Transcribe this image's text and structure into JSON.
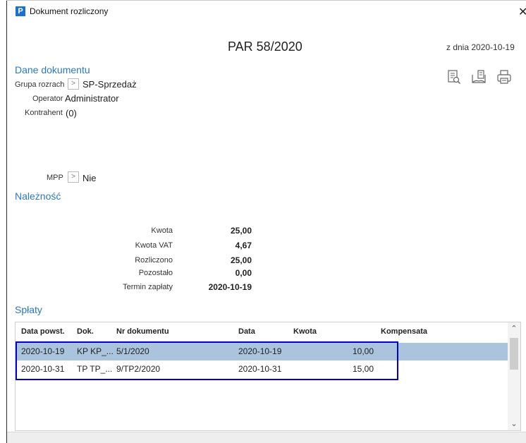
{
  "window": {
    "title": "Dokument rozliczony",
    "app_icon_letter": "P",
    "close_glyph": "✕"
  },
  "document": {
    "number": "PAR 58/2020",
    "date": "z dnia 2020-10-19"
  },
  "details": {
    "section_title": "Dane dokumentu",
    "grupa_label": "Grupa rozrach",
    "grupa_value": "SP-Sprzedaż",
    "operator_label": "Operator",
    "operator_value": "Administrator",
    "kontrahent_label": "Kontrahent",
    "kontrahent_value": "(0)",
    "mpp_label": "MPP",
    "mpp_value": "Nie"
  },
  "receivable": {
    "section_title": "Należność",
    "rows": [
      {
        "label": "Kwota",
        "value": "25,00"
      },
      {
        "label": "Kwota VAT",
        "value": "4,67"
      },
      {
        "label": "Rozliczono",
        "value": "25,00"
      },
      {
        "label": "Pozostało",
        "value": "0,00"
      },
      {
        "label": "Termin zapłaty",
        "value": "2020-10-19"
      }
    ]
  },
  "payments": {
    "section_title": "Spłaty",
    "columns": {
      "data_powst": "Data powst.",
      "dok": "Dok.",
      "nr": "Nr dokumentu",
      "data": "Data",
      "kwota": "Kwota",
      "kompensata": "Kompensata"
    },
    "rows": [
      {
        "data_powst": "2020-10-19",
        "dok": "KP KP_...",
        "nr": "5/1/2020",
        "data": "2020-10-19",
        "kwota": "10,00",
        "kompensata": ""
      },
      {
        "data_powst": "2020-10-31",
        "dok": "TP TP_...",
        "nr": "9/TP2/2020",
        "data": "2020-10-31",
        "kwota": "15,00",
        "kompensata": ""
      }
    ]
  },
  "toolbar_icons": [
    "preview-document-icon",
    "open-book-icon",
    "print-icon"
  ],
  "bottom_icons": [
    "preview-document-icon",
    "open-book-icon",
    "unlink-document-icon",
    "remove-document-icon"
  ],
  "colors": {
    "accent": "#2a78c8",
    "selection": "#a9c4dc",
    "highlight_border": "#0000d4"
  }
}
